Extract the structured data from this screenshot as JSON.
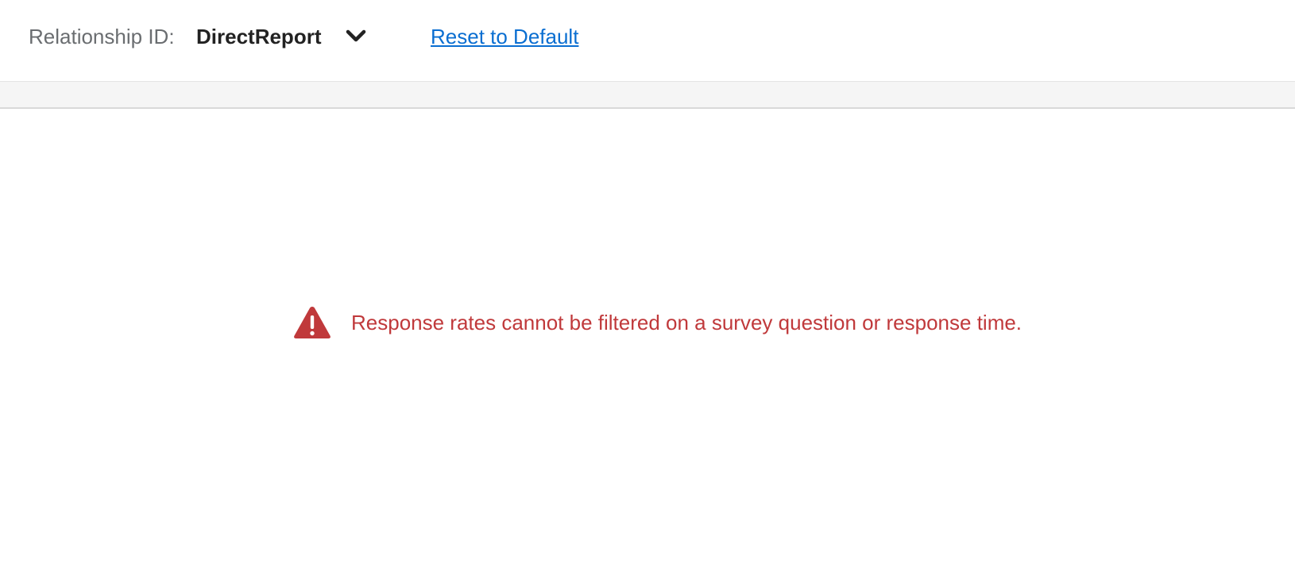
{
  "filter_bar": {
    "relationship_label": "Relationship ID:",
    "relationship_value": "DirectReport",
    "dropdown_icon": "chevron-down-icon",
    "reset_link": "Reset to Default"
  },
  "message": {
    "icon": "warning-icon",
    "text": "Response rates cannot be filtered on a survey question or response time."
  },
  "colors": {
    "error": "#c0393b",
    "link": "#0a6ed1",
    "label": "#6a6d70",
    "value": "#222222"
  }
}
